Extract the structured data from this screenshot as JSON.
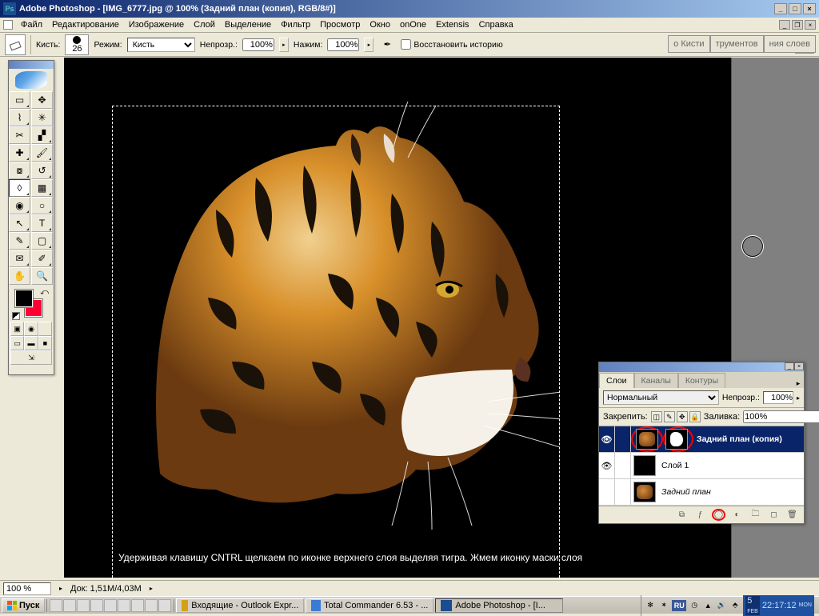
{
  "titlebar": {
    "app_name": "Adobe Photoshop",
    "doc_title": "[IMG_6777.jpg @ 100% (Задний план (копия), RGB/8#)]"
  },
  "menu": {
    "items": [
      "Файл",
      "Редактирование",
      "Изображение",
      "Слой",
      "Выделение",
      "Фильтр",
      "Просмотр",
      "Окно",
      "onOne",
      "Extensis",
      "Справка"
    ]
  },
  "options": {
    "brush_label": "Кисть:",
    "brush_size": "26",
    "mode_label": "Режим:",
    "mode_value": "Кисть",
    "opacity_label": "Непрозр.:",
    "opacity_value": "100%",
    "flow_label": "Нажим:",
    "flow_value": "100%",
    "history_checkbox": "Восстановить историю"
  },
  "collapsed_tabs": [
    "о Кисти",
    "трументов",
    "ния слоев"
  ],
  "layers_panel": {
    "tabs": [
      "Слои",
      "Каналы",
      "Контуры"
    ],
    "active_tab": 0,
    "blend_mode": "Нормальный",
    "opacity_label": "Непрозр.:",
    "opacity_value": "100%",
    "lock_label": "Закрепить:",
    "fill_label": "Заливка:",
    "fill_value": "100%",
    "layers": [
      {
        "name": "Задний план (копия)",
        "selected": true,
        "has_mask": true
      },
      {
        "name": "Слой 1",
        "selected": false,
        "has_mask": false
      },
      {
        "name": "Задний план",
        "selected": false,
        "has_mask": false,
        "italic": true
      }
    ]
  },
  "canvas": {
    "caption": "Удерживая клавишу CNTRL щелкаем по иконке верхнего слоя выделяя тигра.  Жмем иконку маски слоя"
  },
  "status": {
    "zoom": "100 %",
    "doc_info": "Док: 1,51M/4,03M"
  },
  "taskbar": {
    "start": "Пуск",
    "tasks": [
      {
        "label": "Входящие - Outlook Expr...",
        "active": false
      },
      {
        "label": "Total Commander 6.53 - ...",
        "active": false
      },
      {
        "label": "Adobe Photoshop - [I...",
        "active": true
      }
    ],
    "lang": "RU",
    "date_day": "5",
    "date_mon": "FEB",
    "time": "22:17:12",
    "dow": "MON"
  }
}
